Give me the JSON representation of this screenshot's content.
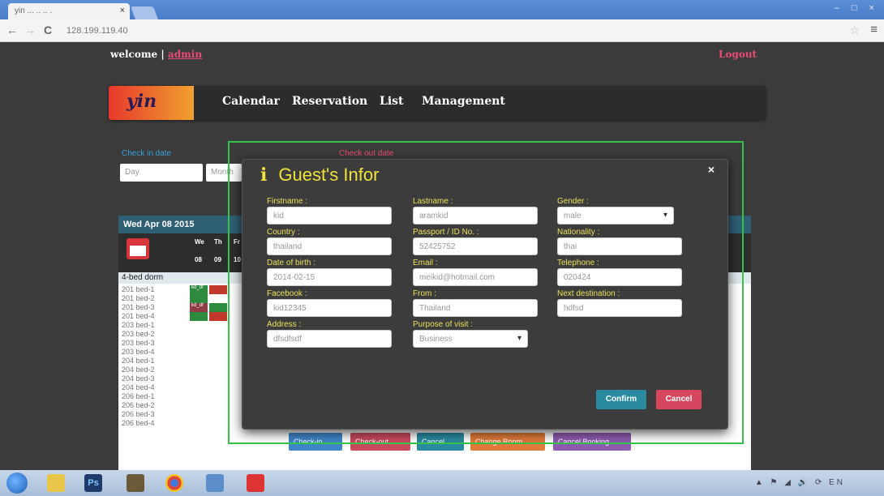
{
  "browser": {
    "tab_title": "yin ... .. .. .",
    "tab_close": "×",
    "window_controls": "– □ ×",
    "back": "←",
    "forward": "→",
    "reload": "C",
    "url": "128.199.119.40",
    "star": "☆",
    "menu": "≡"
  },
  "header": {
    "welcome": "welcome",
    "separator": "|",
    "user": "admin",
    "logout": "Logout"
  },
  "nav": {
    "logo": "yin",
    "items": [
      "Calendar",
      "Reservation",
      "List",
      "Management"
    ]
  },
  "filters": {
    "checkin_label": "Check in date",
    "checkout_label": "Check out date",
    "day_select": "Day",
    "month_select": "Month"
  },
  "calendar": {
    "date_header": "Wed Apr 08 2015",
    "days": [
      {
        "dow": "We",
        "num": "08"
      },
      {
        "dow": "Th",
        "num": "09"
      },
      {
        "dow": "Fr",
        "num": "10"
      }
    ],
    "room_type": "4-bed dorm",
    "beds": [
      "201 bed-1",
      "201 bed-2",
      "201 bed-3",
      "201 bed-4",
      "203 bed-1",
      "203 bed-2",
      "203 bed-3",
      "203 bed-4",
      "204 bed-1",
      "204 bed-2",
      "204 bed-3",
      "204 bed-4",
      "206 bed-1",
      "206 bed-2",
      "206 bed-3",
      "206 bed-4"
    ],
    "booking_label": "kd_df"
  },
  "modal": {
    "icon": "i",
    "title": "Guest's Infor",
    "close": "×",
    "fields": {
      "firstname": {
        "label": "Firstname :",
        "value": "kid"
      },
      "lastname": {
        "label": "Lastname :",
        "value": "aramkid"
      },
      "gender": {
        "label": "Gender :",
        "value": "male"
      },
      "country": {
        "label": "Country :",
        "value": "thailand"
      },
      "passport": {
        "label": "Passport / ID No. :",
        "value": "52425752"
      },
      "nationality": {
        "label": "Nationality :",
        "value": "thai"
      },
      "dob": {
        "label": "Date of birth :",
        "value": "2014-02-15"
      },
      "email": {
        "label": "Email :",
        "value": "meikid@hotmail.com"
      },
      "telephone": {
        "label": "Telephone :",
        "value": "020424"
      },
      "facebook": {
        "label": "Facebook :",
        "value": "kid12345"
      },
      "from": {
        "label": "From :",
        "value": "Thailand"
      },
      "next_destination": {
        "label": "Next destination :",
        "value": "hdfsd"
      },
      "address": {
        "label": "Address :",
        "value": "dfsdfsdf"
      },
      "purpose": {
        "label": "Purpose of visit :",
        "value": "Business"
      }
    },
    "confirm": "Confirm",
    "cancel": "Cancel"
  },
  "bottom_buttons": [
    "Check-in",
    "Check-out",
    "Cancel",
    "Change Room",
    "Cancel Booking"
  ],
  "taskbar": {
    "icons": [
      "explorer-icon",
      "photoshop-icon",
      "media-icon",
      "chrome-icon",
      "files-icon",
      "pdf-icon"
    ],
    "ps_label": "Ps",
    "tray": "▲ ⚑ ◢ 🔊 ⟳ EN"
  },
  "colors": {
    "accent_yellow": "#f0e23c",
    "confirm": "#2a8ba0",
    "cancel": "#d6465e",
    "highlight_border": "#35c24a",
    "admin_pink": "#e94b73"
  }
}
